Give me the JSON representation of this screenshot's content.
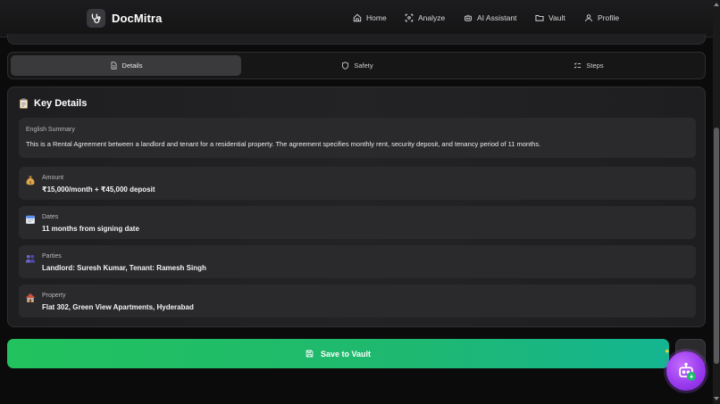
{
  "brand": {
    "name": "DocMitra"
  },
  "nav": {
    "items": [
      {
        "label": "Home",
        "icon": "home-icon"
      },
      {
        "label": "Analyze",
        "icon": "scan-icon"
      },
      {
        "label": "AI Assistant",
        "icon": "bot-icon"
      },
      {
        "label": "Vault",
        "icon": "folder-icon"
      },
      {
        "label": "Profile",
        "icon": "user-icon"
      }
    ]
  },
  "tabs": [
    {
      "label": "Details",
      "icon": "document-icon",
      "active": true
    },
    {
      "label": "Safety",
      "icon": "shield-icon",
      "active": false
    },
    {
      "label": "Steps",
      "icon": "checklist-icon",
      "active": false
    }
  ],
  "key_details": {
    "title": "Key Details",
    "title_icon": "clipboard-icon",
    "summary_label": "English Summary",
    "summary_text": "This is a Rental Agreement between a landlord and tenant for a residential property. The agreement specifies monthly rent, security deposit, and tenancy period of 11 months.",
    "rows": [
      {
        "label": "Amount",
        "value": "₹15,000/month + ₹45,000 deposit",
        "icon": "money-bag-icon"
      },
      {
        "label": "Dates",
        "value": "11 months from signing date",
        "icon": "calendar-icon"
      },
      {
        "label": "Parties",
        "value": "Landlord: Suresh Kumar, Tenant: Ramesh Singh",
        "icon": "people-icon"
      },
      {
        "label": "Property",
        "value": "Flat 302, Green View Apartments, Hyderabad",
        "icon": "house-icon"
      }
    ]
  },
  "actions": {
    "save_label": "Save to Vault",
    "save_icon": "save-icon"
  },
  "colors": {
    "accent_green_start": "#22c25e",
    "accent_green_end": "#14b591",
    "fab_purple": "#9b3bef",
    "background": "#0b0b0c"
  }
}
